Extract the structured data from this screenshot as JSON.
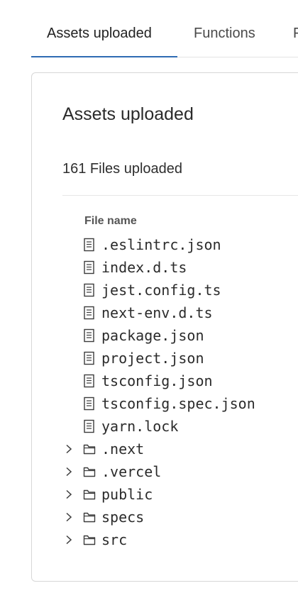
{
  "tabs": [
    {
      "label": "Assets uploaded",
      "active": true
    },
    {
      "label": "Functions",
      "active": false
    },
    {
      "label": "F",
      "active": false
    }
  ],
  "card": {
    "title": "Assets uploaded",
    "count_text": "161 Files uploaded",
    "column_header": "File name"
  },
  "files": [
    {
      "name": ".eslintrc.json",
      "icon": "file-icon"
    },
    {
      "name": "index.d.ts",
      "icon": "file-icon"
    },
    {
      "name": "jest.config.ts",
      "icon": "file-icon"
    },
    {
      "name": "next-env.d.ts",
      "icon": "file-icon"
    },
    {
      "name": "package.json",
      "icon": "file-icon"
    },
    {
      "name": "project.json",
      "icon": "file-icon"
    },
    {
      "name": "tsconfig.json",
      "icon": "file-icon"
    },
    {
      "name": "tsconfig.spec.json",
      "icon": "file-icon"
    },
    {
      "name": "yarn.lock",
      "icon": "file-icon"
    }
  ],
  "folders": [
    {
      "name": ".next",
      "icon": "folder-icon",
      "expanded": false
    },
    {
      "name": ".vercel",
      "icon": "folder-icon",
      "expanded": false
    },
    {
      "name": "public",
      "icon": "folder-icon",
      "expanded": false
    },
    {
      "name": "specs",
      "icon": "folder-icon",
      "expanded": false
    },
    {
      "name": "src",
      "icon": "folder-icon",
      "expanded": false
    }
  ],
  "colors": {
    "accent": "#2f6bb3",
    "border": "#d7d7d7",
    "text": "#2e2e2e"
  }
}
